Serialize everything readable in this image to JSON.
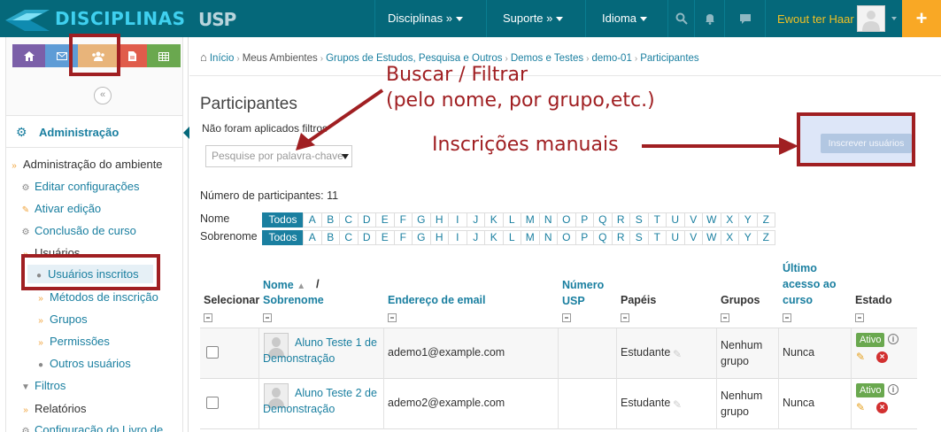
{
  "navbar": {
    "brand": "DISCIPLINAS",
    "usp_logo": "USP",
    "menu": [
      {
        "label": "Disciplinas »"
      },
      {
        "label": "Suporte »"
      },
      {
        "label": "Idioma"
      }
    ],
    "icons": [
      "search-icon",
      "bell-icon",
      "chat-icon"
    ],
    "user_name": "Ewout ter Haar",
    "plus": "+"
  },
  "sidebar": {
    "quick_buttons": [
      {
        "icon": "home-icon",
        "color": "#7b5fa8"
      },
      {
        "icon": "mail-icon",
        "color": "#5e9cd6"
      },
      {
        "icon": "users-icon",
        "color": "#e8b47a"
      },
      {
        "icon": "document-icon",
        "color": "#e05c4b"
      },
      {
        "icon": "grid-icon",
        "color": "#6aa84f"
      }
    ],
    "admin_title": "Administração",
    "tree": [
      {
        "label": "Administração do ambiente",
        "type": "plain",
        "icon": "chevron-icon"
      },
      {
        "label": "Editar configurações",
        "type": "link",
        "icon": "gear-icon"
      },
      {
        "label": "Ativar edição",
        "type": "link",
        "icon": "pencil-icon"
      },
      {
        "label": "Conclusão de curso",
        "type": "link",
        "icon": "gear-icon"
      },
      {
        "label": "Usuários",
        "type": "plain",
        "icon": "chevron-icon"
      },
      {
        "label": "Usuários inscritos",
        "type": "link",
        "icon": "user-icon"
      },
      {
        "label": "Métodos de inscrição",
        "type": "link",
        "icon": "chevron-icon"
      },
      {
        "label": "Grupos",
        "type": "link",
        "icon": "chevron-icon"
      },
      {
        "label": "Permissões",
        "type": "link",
        "icon": "chevron-icon"
      },
      {
        "label": "Outros usuários",
        "type": "link",
        "icon": "user-icon"
      },
      {
        "label": "Filtros",
        "type": "link",
        "icon": "filter-icon"
      },
      {
        "label": "Relatórios",
        "type": "plain",
        "icon": "chevron-icon"
      },
      {
        "label": "Configuração do Livro de",
        "type": "link",
        "icon": "gear-icon"
      }
    ]
  },
  "breadcrumb": {
    "items": [
      {
        "label": "Início",
        "type": "link"
      },
      {
        "label": "Meus Ambientes",
        "type": "plain"
      },
      {
        "label": "Grupos de Estudos, Pesquisa e Outros",
        "type": "link"
      },
      {
        "label": "Demos e Testes",
        "type": "link"
      },
      {
        "label": "demo-01",
        "type": "link"
      },
      {
        "label": "Participantes",
        "type": "link"
      }
    ]
  },
  "main": {
    "title": "Participantes",
    "filter_note": "Não foram aplicados filtros",
    "search_placeholder": "Pesquise por palavra-chave",
    "enrol_button": "Inscrever usuários",
    "participant_count": "Número de participantes: 11",
    "first_name_label": "Nome",
    "last_name_label": "Sobrenome",
    "all_label": "Todos",
    "letters": [
      "A",
      "B",
      "C",
      "D",
      "E",
      "F",
      "G",
      "H",
      "I",
      "J",
      "K",
      "L",
      "M",
      "N",
      "O",
      "P",
      "Q",
      "R",
      "S",
      "T",
      "U",
      "V",
      "W",
      "X",
      "Y",
      "Z"
    ]
  },
  "table": {
    "headers": {
      "select": "Selecionar",
      "first_name": "Nome",
      "last_name": "Sobrenome",
      "email": "Endereço de email",
      "usp_number_1": "Número",
      "usp_number_2": "USP",
      "roles": "Papéis",
      "groups": "Grupos",
      "last_access_1": "Último",
      "last_access_2": "acesso ao",
      "last_access_3": "curso",
      "status": "Estado"
    },
    "rows": [
      {
        "name": "Aluno Teste 1 de Demonstração",
        "email": "ademo1@example.com",
        "usp": "",
        "role": "Estudante",
        "groups": "Nenhum grupo",
        "last_access": "Nunca",
        "status": "Ativo"
      },
      {
        "name": "Aluno Teste 2 de Demonstração",
        "email": "ademo2@example.com",
        "usp": "",
        "role": "Estudante",
        "groups": "Nenhum grupo",
        "last_access": "Nunca",
        "status": "Ativo"
      }
    ]
  },
  "annotations": {
    "search_line1": "Buscar / Filtrar",
    "search_line2": "(pelo nome, por grupo,etc.)",
    "manual": "Inscrições manuais",
    "color": "#a01f22"
  }
}
